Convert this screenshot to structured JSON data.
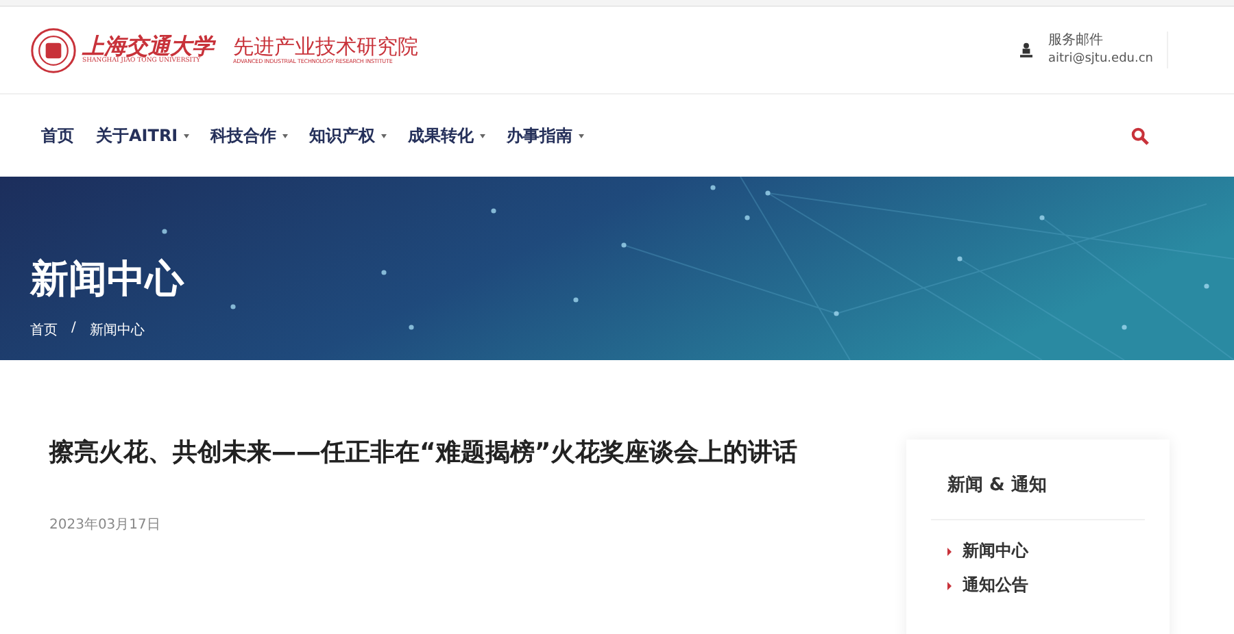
{
  "header": {
    "logo": {
      "university_cn": "上海交通大学",
      "university_en": "SHANGHAI JIAO TONG UNIVERSITY",
      "institute_cn": "先进产业技术研究院",
      "institute_en": "ADVANCED INDUSTRIAL TECHNOLOGY RESEARCH INSTITUTE"
    },
    "contact": {
      "label": "服务邮件",
      "email": "aitri@sjtu.edu.cn"
    }
  },
  "nav": {
    "items": [
      {
        "label": "首页",
        "has_menu": false
      },
      {
        "label": "关于AITRI",
        "has_menu": true
      },
      {
        "label": "科技合作",
        "has_menu": true
      },
      {
        "label": "知识产权",
        "has_menu": true
      },
      {
        "label": "成果转化",
        "has_menu": true
      },
      {
        "label": "办事指南",
        "has_menu": true
      }
    ]
  },
  "banner": {
    "title": "新闻中心",
    "breadcrumb": [
      "首页",
      "新闻中心"
    ],
    "separator": "/"
  },
  "article": {
    "title": "擦亮火花、共创未来——任正非在“难题揭榜”火花奖座谈会上的讲话",
    "date": "2023年03月17日"
  },
  "sidebar": {
    "title": "新闻 & 通知",
    "links": [
      "新闻中心",
      "通知公告"
    ]
  }
}
